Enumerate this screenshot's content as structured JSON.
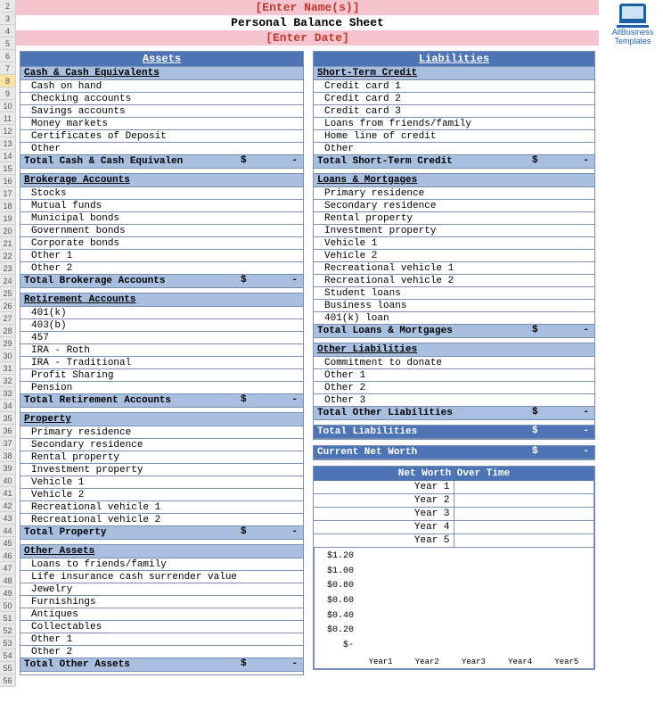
{
  "header": {
    "name_placeholder": "[Enter Name(s)]",
    "title": "Personal Balance Sheet",
    "date_placeholder": "[Enter Date]"
  },
  "logo": {
    "line1": "AllBusiness",
    "line2": "Templates"
  },
  "row_numbers": [
    "2",
    "3",
    "4",
    "5",
    "6",
    "7",
    "8",
    "9",
    "10",
    "11",
    "12",
    "13",
    "14",
    "15",
    "16",
    "17",
    "18",
    "19",
    "20",
    "21",
    "22",
    "23",
    "24",
    "25",
    "26",
    "27",
    "28",
    "29",
    "30",
    "31",
    "32",
    "33",
    "34",
    "35",
    "36",
    "37",
    "38",
    "39",
    "40",
    "41",
    "42",
    "43",
    "44",
    "45",
    "46",
    "47",
    "48",
    "49",
    "50",
    "51",
    "52",
    "53",
    "54",
    "55",
    "56"
  ],
  "currency": "$",
  "dash": "-",
  "assets": {
    "heading": "Assets",
    "sections": [
      {
        "name": "Cash & Cash Equivalents",
        "items": [
          "Cash on hand",
          "Checking accounts",
          "Savings accounts",
          "Money markets",
          "Certificates of Deposit",
          "Other"
        ],
        "total_label": "Total Cash & Cash Equivalen"
      },
      {
        "name": "Brokerage Accounts",
        "items": [
          "Stocks",
          "Mutual funds",
          "Municipal bonds",
          "Government bonds",
          "Corporate bonds",
          "Other 1",
          "Other 2"
        ],
        "total_label": "Total Brokerage Accounts"
      },
      {
        "name": "Retirement Accounts",
        "items": [
          "401(k)",
          "403(b)",
          "457",
          "IRA - Roth",
          "IRA - Traditional",
          "Profit Sharing",
          "Pension"
        ],
        "total_label": "Total Retirement Accounts"
      },
      {
        "name": "Property",
        "items": [
          "Primary  residence",
          "Secondary residence",
          "Rental property",
          "Investment property",
          "Vehicle 1",
          "Vehicle 2",
          "Recreational vehicle 1",
          "Recreational vehicle 2"
        ],
        "total_label": "Total Property"
      },
      {
        "name": "Other Assets",
        "items": [
          "Loans to friends/family",
          "Life insurance cash surrender value",
          "Jewelry",
          "Furnishings",
          "Antiques",
          "Collectables",
          "Other 1",
          "Other 2"
        ],
        "total_label": "Total Other Assets"
      }
    ]
  },
  "liabilities": {
    "heading": "Liabilities",
    "sections": [
      {
        "name": "Short-Term Credit",
        "items": [
          "Credit card 1",
          "Credit card 2",
          "Credit card 3",
          "Loans from friends/family",
          "Home line of credit",
          "Other"
        ],
        "total_label": "Total Short-Term Credit"
      },
      {
        "name": "Loans & Mortgages",
        "items": [
          "Primary  residence",
          "Secondary residence",
          "Rental property",
          "Investment property",
          "Vehicle 1",
          "Vehicle 2",
          "Recreational vehicle 1",
          "Recreational vehicle 2",
          "Student loans",
          "Business loans",
          "401(k) loan"
        ],
        "total_label": "Total Loans & Mortgages"
      },
      {
        "name": "Other Liabilities",
        "items": [
          "Commitment to donate",
          "Other 1",
          "Other 2",
          "Other 3"
        ],
        "total_label": "Total Other Liabilities"
      }
    ],
    "grand_total_label": "Total Liabilities"
  },
  "networth": {
    "current_label": "Current Net Worth",
    "over_time_label": "Net Worth Over Time",
    "years": [
      "Year 1",
      "Year 2",
      "Year 3",
      "Year 4",
      "Year 5"
    ]
  },
  "chart_data": {
    "type": "bar",
    "title": "Net Worth Over Time",
    "categories": [
      "Year1",
      "Year2",
      "Year3",
      "Year4",
      "Year5"
    ],
    "values": [
      0,
      0,
      0,
      0,
      0
    ],
    "ylabel": "",
    "y_ticks": [
      "$1.20",
      "$1.00",
      "$0.80",
      "$0.60",
      "$0.40",
      "$0.20",
      "$-"
    ],
    "ylim": [
      0,
      1.2
    ]
  }
}
